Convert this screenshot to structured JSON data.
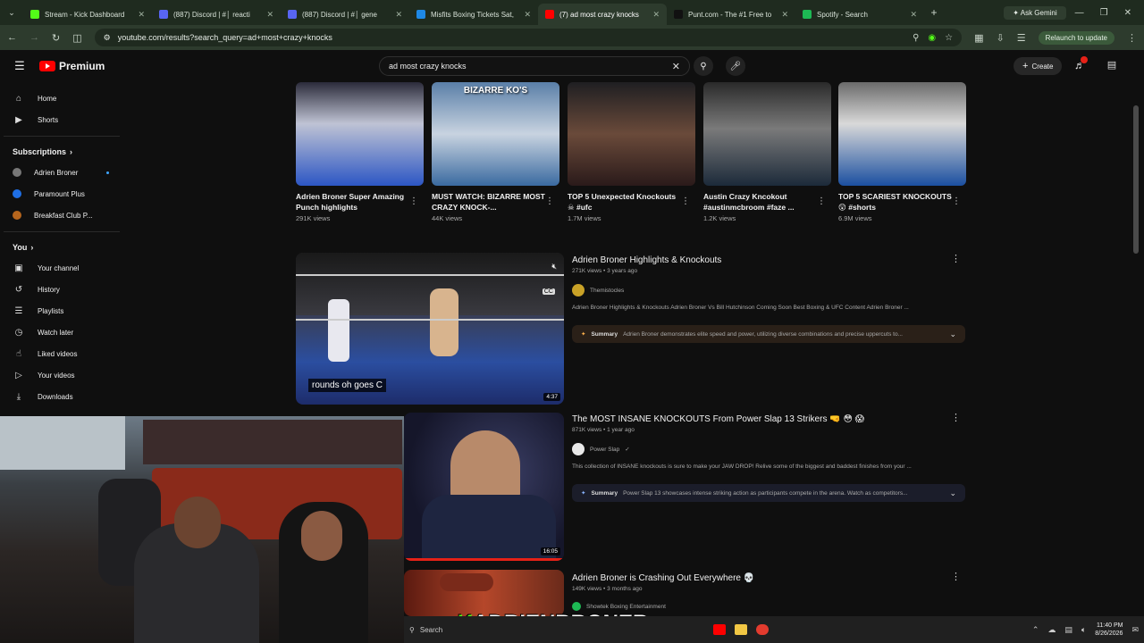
{
  "browser": {
    "tabs": [
      {
        "title": "Stream - Kick Dashboard",
        "color": "#53fc18",
        "active": false
      },
      {
        "title": "(887) Discord | #│ reacti",
        "color": "#5865f2",
        "active": false
      },
      {
        "title": "(887) Discord | #│ gene",
        "color": "#5865f2",
        "active": false
      },
      {
        "title": "Misfits Boxing Tickets Sat,",
        "color": "#1e88e5",
        "active": false
      },
      {
        "title": "(7) ad most crazy knocks",
        "color": "#ff0000",
        "active": true
      },
      {
        "title": "Punt.com - The #1 Free to",
        "color": "#111111",
        "active": false
      },
      {
        "title": "Spotify - Search",
        "color": "#1db954",
        "active": false
      }
    ],
    "ask_gemini": "Ask Gemini",
    "url": "youtube.com/results?search_query=ad+most+crazy+knocks",
    "relaunch": "Relaunch to update"
  },
  "youtube": {
    "brand": "Premium",
    "search_query": "ad most crazy knocks",
    "create_label": "Create"
  },
  "sidebar": {
    "main": [
      {
        "label": "Home",
        "icon": "⌂"
      },
      {
        "label": "Shorts",
        "icon": "▶"
      }
    ],
    "subscriptions_heading": "Subscriptions",
    "subscriptions": [
      {
        "label": "Adrien Broner",
        "color": "#777777"
      },
      {
        "label": "Paramount Plus",
        "color": "#1f6fe5"
      },
      {
        "label": "Breakfast Club P...",
        "color": "#b5651d"
      }
    ],
    "you_heading": "You",
    "you": [
      {
        "label": "Your channel",
        "icon": "▣"
      },
      {
        "label": "History",
        "icon": "↺"
      },
      {
        "label": "Playlists",
        "icon": "☰"
      },
      {
        "label": "Watch later",
        "icon": "◷"
      },
      {
        "label": "Liked videos",
        "icon": "☝"
      },
      {
        "label": "Your videos",
        "icon": "▷"
      },
      {
        "label": "Downloads",
        "icon": "⤓"
      }
    ]
  },
  "shorts": [
    {
      "title": "Adrien Broner  Super Amazing Punch highlights",
      "views": "291K views",
      "tag": ""
    },
    {
      "title": "MUST WATCH: BIZARRE MOST CRAZY KNOCK-...",
      "views": "44K views",
      "tag": "BIZARRE KO'S"
    },
    {
      "title": "TOP 5 Unexpected Knockouts ☠ #ufc",
      "views": "1.7M views",
      "tag": ""
    },
    {
      "title": "Austin Crazy Kncokout #austinmcbroom #faze ...",
      "views": "1.2K views",
      "tag": ""
    },
    {
      "title": "TOP 5 SCARIEST KNOCKOUTS 😲 #shorts",
      "views": "6.9M views",
      "tag": ""
    }
  ],
  "videos": [
    {
      "title": "Adrien Broner Highlights & Knockouts",
      "meta": "271K views • 3 years ago",
      "channel": "Themistocles",
      "desc": "Adrien Broner Highlights & Knockouts Adrien Broner Vs Bill Hutchinson Coming Soon Best Boxing & UFC Content Adrien Broner ...",
      "summary_label": "Summary",
      "summary": "Adrien Broner demonstrates elite speed and power, utilizing diverse combinations and precise uppercuts to...",
      "caption": "rounds oh goes C",
      "duration": "4:37"
    },
    {
      "title": "The MOST INSANE KNOCKOUTS From Power Slap 13 Strikers 🤜 😳 😱",
      "meta": "871K views • 1 year ago",
      "channel": "Power Slap",
      "desc": "This collection of INSANE knockouts is sure to make your JAW DROP! Relive some of the biggest and baddest finishes from your ...",
      "summary_label": "Summary",
      "summary": "Power Slap 13 showcases intense striking action as participants compete in the arena. Watch as competitors...",
      "duration": "16:05"
    },
    {
      "title": "Adrien Broner is Crashing Out Everywhere 💀",
      "meta": "149K views • 3 months ago",
      "channel": "Showtek Boxing Entertainment"
    }
  ],
  "overlay": {
    "k": "K",
    "rest": "ADRIENBRONER"
  },
  "taskbar": {
    "search": "Search",
    "time": "11:40 PM",
    "date": "8/26/2026"
  }
}
